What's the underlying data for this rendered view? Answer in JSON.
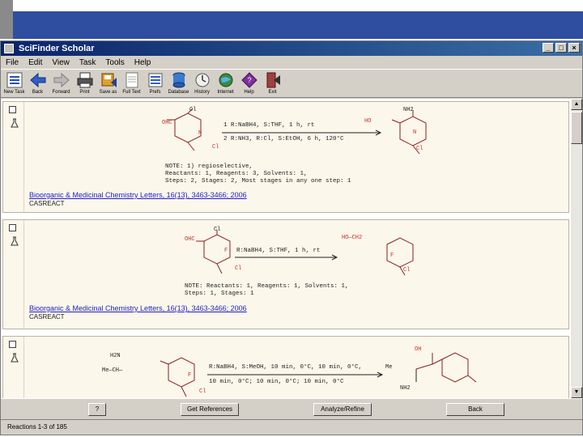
{
  "window": {
    "title": "SciFinder Scholar"
  },
  "menu": [
    "File",
    "Edit",
    "View",
    "Task",
    "Tools",
    "Help"
  ],
  "toolbar": [
    "New Task",
    "Back",
    "Forward",
    "Print",
    "Save as",
    "Full Text",
    "Prefs",
    "Database",
    "History",
    "Internet",
    "Help",
    "Exit"
  ],
  "records": [
    {
      "reactant_labels": [
        "Cl",
        "OHC",
        "N",
        "Cl"
      ],
      "conditions": [
        "1  R:NaBH4, S:THF, 1 h, rt",
        "2  R:NH3, R:Cl, S:EtOH, 6 h, 120°C"
      ],
      "product_labels": [
        "NH2",
        "HO",
        "N",
        "Cl"
      ],
      "notes": [
        "NOTE: 1) regioselective,",
        "Reactants: 1, Reagents: 3, Solvents: 1,",
        "Steps: 2, Stages: 2, Most stages in any one step: 1"
      ],
      "citation": "Bioorganic & Medicinal Chemistry Letters, 16(13), 3463-3466; 2006",
      "source": "CASREACT"
    },
    {
      "reactant_labels": [
        "Cl",
        "OHC",
        "F",
        "Cl"
      ],
      "conditions": [
        "R:NaBH4, S:THF, 1 h, rt"
      ],
      "product_labels": [
        "HO—CH2",
        "F",
        "Cl"
      ],
      "notes": [
        "NOTE: Reactants: 1, Reagents: 1, Solvents: 1,",
        "Steps: 1, Stages: 1"
      ],
      "citation": "Bioorganic & Medicinal Chemistry Letters, 16(13), 3463-3466; 2006",
      "source": "CASREACT"
    },
    {
      "reactant_labels": [
        "H2N",
        "Me—CH—",
        "F",
        "Cl"
      ],
      "conditions": [
        "R:NaBH4, S:MeOH, 10 min, 0°C, 10 min, 0°C,",
        "10 min, 0°C; 10 min, 0°C; 10 min, 0°C"
      ],
      "product_labels": [
        "OH",
        "Me",
        "NH2"
      ]
    }
  ],
  "buttons": {
    "help": "?",
    "get_references": "Get References",
    "analyze_refine": "Analyze/Refine",
    "back": "Back"
  },
  "status": "Reactions 1-3 of 185"
}
